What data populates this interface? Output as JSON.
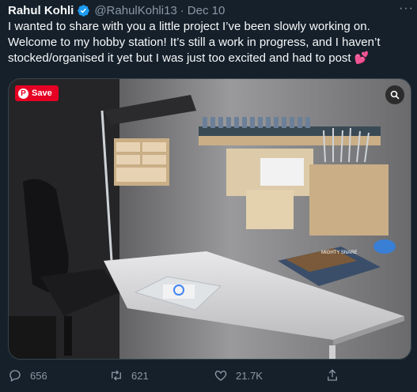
{
  "tweet": {
    "author_name": "Rahul Kohli",
    "handle": "@RahulKohli13",
    "separator": "·",
    "date": "Dec 10",
    "more_label": "···",
    "text": "I wanted to share with you a little project I’ve been slowly working on. Welcome to my hobby station! It’s still a work in progress, and I haven’t stocked/organised it yet but I was just too excited and had to post",
    "emoji": "💕"
  },
  "media": {
    "save_label": "Save",
    "pin_glyph": "P",
    "book_title": "MIGHTY SNARE"
  },
  "actions": {
    "replies": "656",
    "retweets": "621",
    "likes": "21.7K"
  },
  "colors": {
    "background": "#15202b",
    "text": "#f7f9f9",
    "muted": "#8b98a5",
    "verified": "#1d9bf0",
    "pinterest": "#e60023"
  }
}
